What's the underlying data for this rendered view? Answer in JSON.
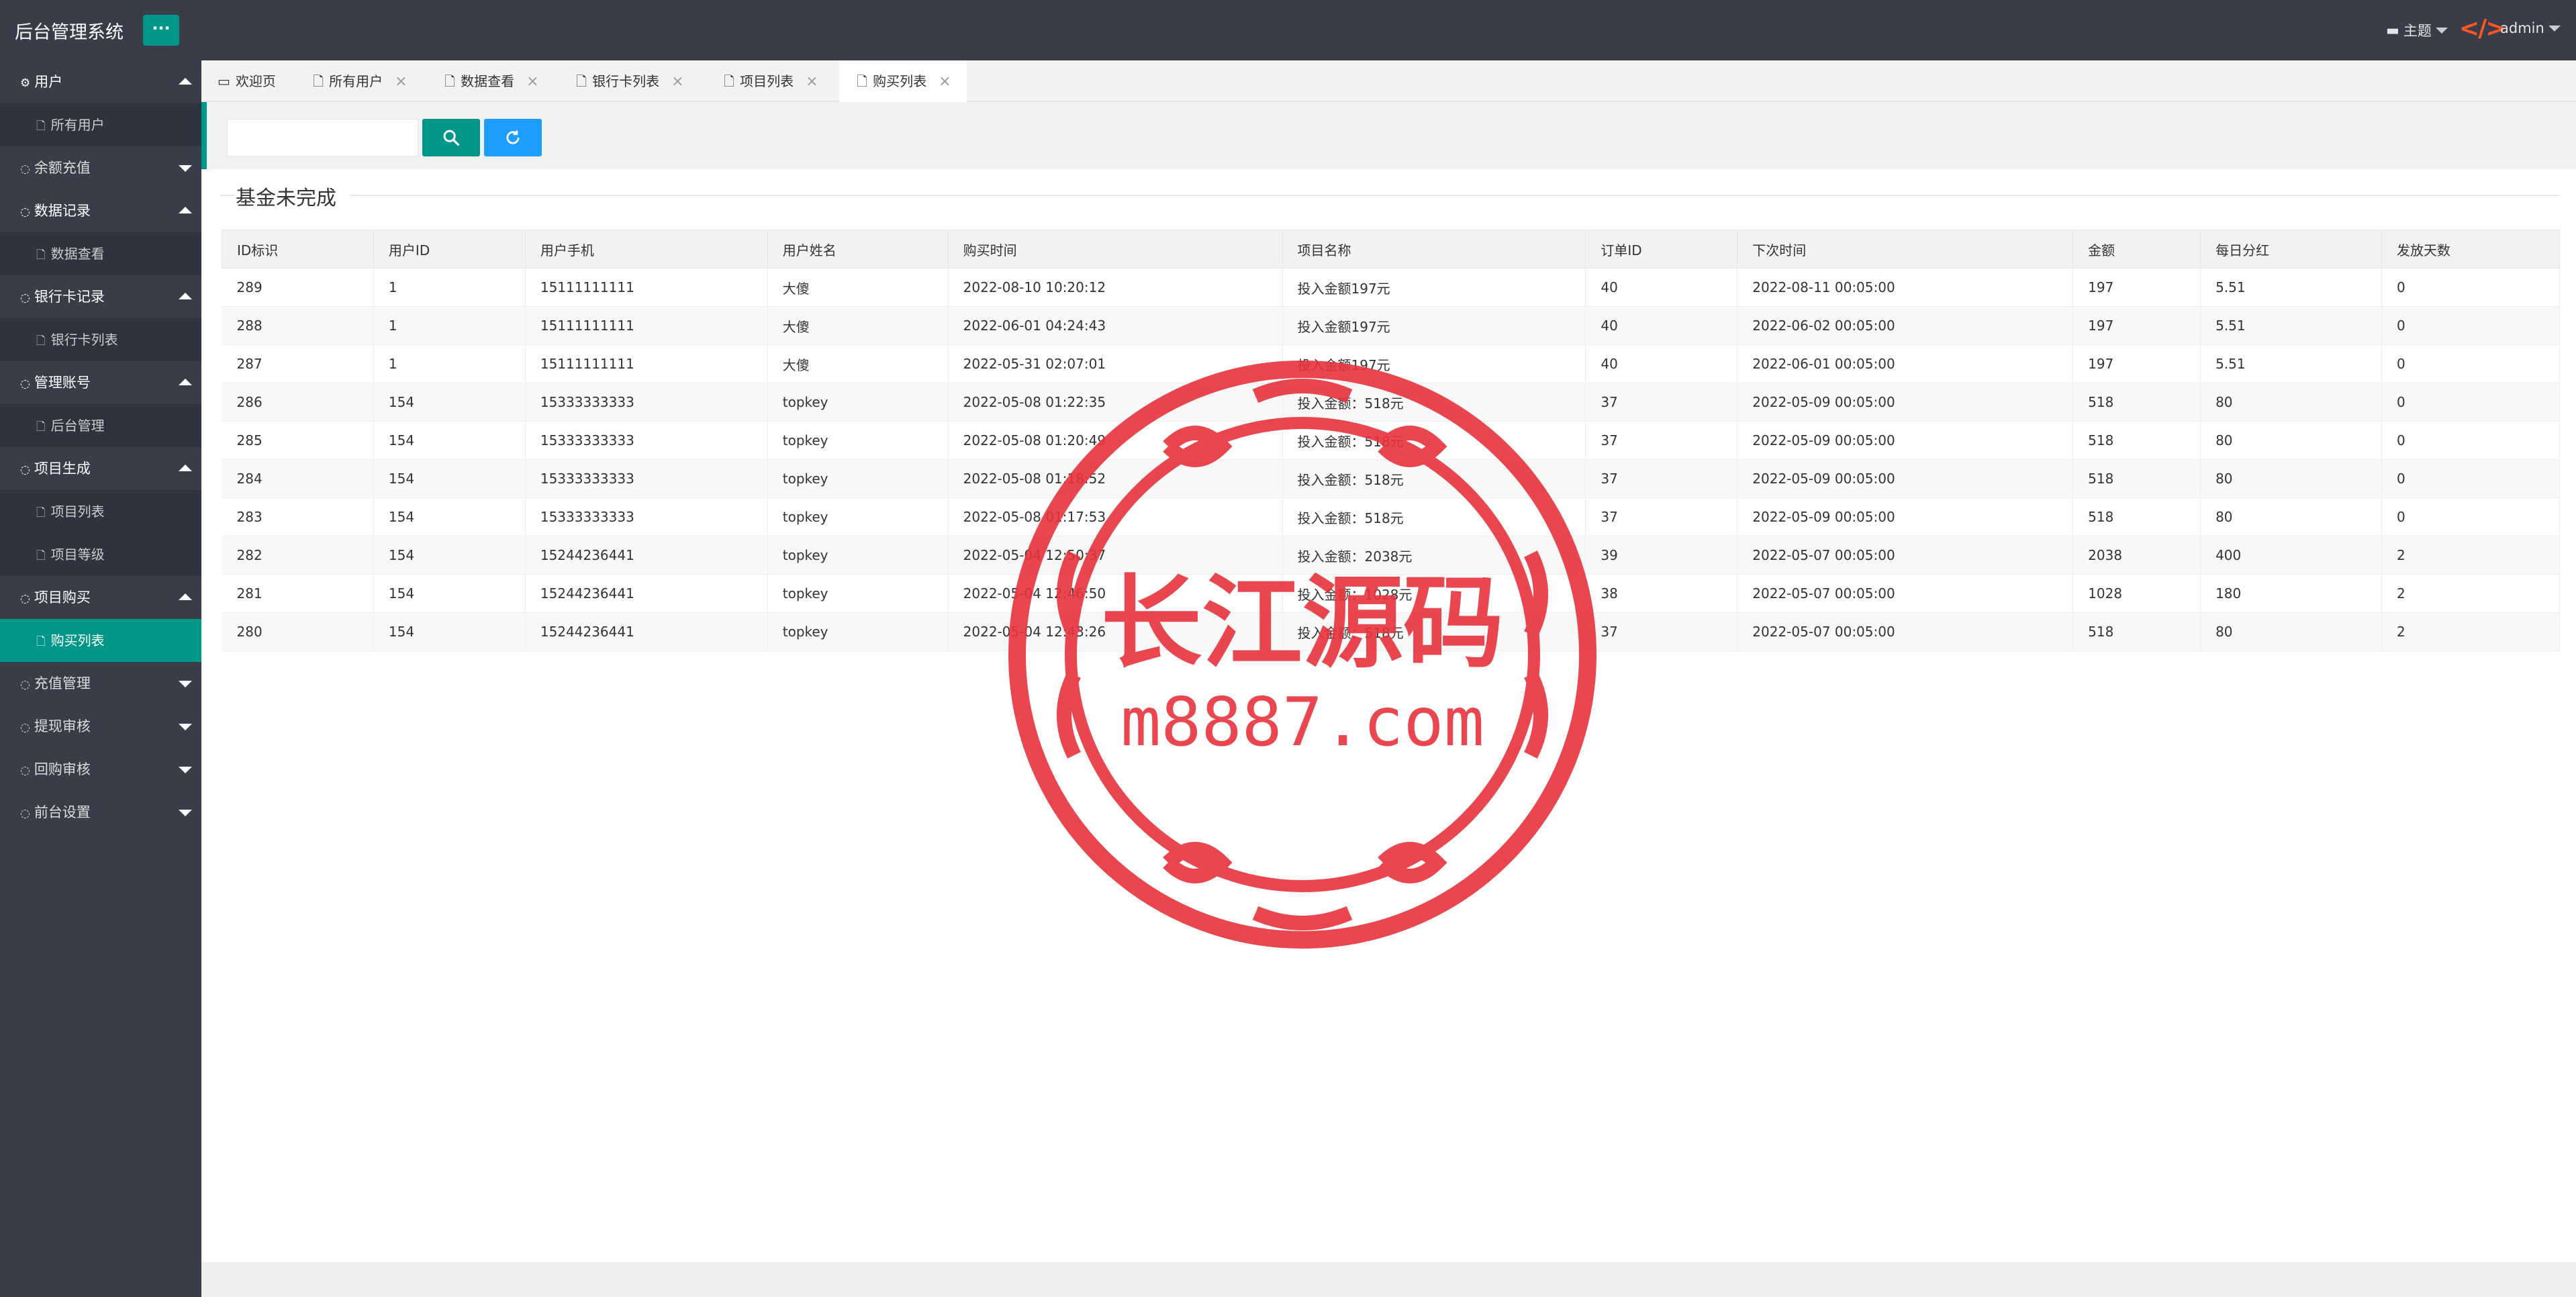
{
  "app": {
    "title": "后台管理系统",
    "menu_button": "···"
  },
  "header": {
    "theme_label": "主题",
    "code_icon": "</>",
    "user": "admin"
  },
  "sidebar": {
    "groups": [
      {
        "label": "用户",
        "icon": "gear-icon",
        "expanded": true,
        "items": [
          "所有用户"
        ]
      },
      {
        "label": "余额充值",
        "icon": "circle-icon",
        "expanded": false,
        "items": []
      },
      {
        "label": "数据记录",
        "icon": "circle-icon",
        "expanded": true,
        "items": [
          "数据查看"
        ]
      },
      {
        "label": "银行卡记录",
        "icon": "circle-icon",
        "expanded": true,
        "items": [
          "银行卡列表"
        ]
      },
      {
        "label": "管理账号",
        "icon": "circle-icon",
        "expanded": true,
        "items": [
          "后台管理"
        ]
      },
      {
        "label": "项目生成",
        "icon": "circle-icon",
        "expanded": true,
        "items": [
          "项目列表",
          "项目等级"
        ]
      },
      {
        "label": "项目购买",
        "icon": "circle-icon",
        "expanded": true,
        "items": [
          "购买列表"
        ]
      },
      {
        "label": "充值管理",
        "icon": "circle-icon",
        "expanded": false,
        "items": []
      },
      {
        "label": "提现审核",
        "icon": "circle-icon",
        "expanded": false,
        "items": []
      },
      {
        "label": "回购审核",
        "icon": "circle-icon",
        "expanded": false,
        "items": []
      },
      {
        "label": "前台设置",
        "icon": "circle-icon",
        "expanded": false,
        "items": []
      }
    ],
    "active_item": "购买列表"
  },
  "tabs": [
    {
      "label": "欢迎页",
      "closable": false,
      "icon": "home-icon"
    },
    {
      "label": "所有用户",
      "closable": true,
      "icon": "file-icon"
    },
    {
      "label": "数据查看",
      "closable": true,
      "icon": "file-icon"
    },
    {
      "label": "银行卡列表",
      "closable": true,
      "icon": "file-icon"
    },
    {
      "label": "项目列表",
      "closable": true,
      "icon": "file-icon"
    },
    {
      "label": "购买列表",
      "closable": true,
      "icon": "file-icon",
      "active": true
    }
  ],
  "search": {
    "value": "",
    "placeholder": ""
  },
  "section": {
    "title": "基金未完成"
  },
  "table": {
    "columns": [
      "ID标识",
      "用户ID",
      "用户手机",
      "用户姓名",
      "购买时间",
      "项目名称",
      "订单ID",
      "下次时间",
      "金额",
      "每日分红",
      "发放天数"
    ],
    "rows": [
      [
        "289",
        "1",
        "15111111111",
        "大傻",
        "2022-08-10 10:20:12",
        "投入金额197元",
        "40",
        "2022-08-11 00:05:00",
        "197",
        "5.51",
        "0"
      ],
      [
        "288",
        "1",
        "15111111111",
        "大傻",
        "2022-06-01 04:24:43",
        "投入金额197元",
        "40",
        "2022-06-02 00:05:00",
        "197",
        "5.51",
        "0"
      ],
      [
        "287",
        "1",
        "15111111111",
        "大傻",
        "2022-05-31 02:07:01",
        "投入金额197元",
        "40",
        "2022-06-01 00:05:00",
        "197",
        "5.51",
        "0"
      ],
      [
        "286",
        "154",
        "15333333333",
        "topkey",
        "2022-05-08 01:22:35",
        "投入金额：518元",
        "37",
        "2022-05-09 00:05:00",
        "518",
        "80",
        "0"
      ],
      [
        "285",
        "154",
        "15333333333",
        "topkey",
        "2022-05-08 01:20:49",
        "投入金额：518元",
        "37",
        "2022-05-09 00:05:00",
        "518",
        "80",
        "0"
      ],
      [
        "284",
        "154",
        "15333333333",
        "topkey",
        "2022-05-08 01:18:52",
        "投入金额：518元",
        "37",
        "2022-05-09 00:05:00",
        "518",
        "80",
        "0"
      ],
      [
        "283",
        "154",
        "15333333333",
        "topkey",
        "2022-05-08 01:17:53",
        "投入金额：518元",
        "37",
        "2022-05-09 00:05:00",
        "518",
        "80",
        "0"
      ],
      [
        "282",
        "154",
        "15244236441",
        "topkey",
        "2022-05-04 12:50:37",
        "投入金额：2038元",
        "39",
        "2022-05-07 00:05:00",
        "2038",
        "400",
        "2"
      ],
      [
        "281",
        "154",
        "15244236441",
        "topkey",
        "2022-05-04 12:46:50",
        "投入金额：1028元",
        "38",
        "2022-05-07 00:05:00",
        "1028",
        "180",
        "2"
      ],
      [
        "280",
        "154",
        "15244236441",
        "topkey",
        "2022-05-04 12:43:26",
        "投入金额：518元",
        "37",
        "2022-05-07 00:05:00",
        "518",
        "80",
        "2"
      ]
    ]
  },
  "watermark": {
    "line1": "长江源码",
    "line2": "m8887.com",
    "color": "#e8323c"
  }
}
